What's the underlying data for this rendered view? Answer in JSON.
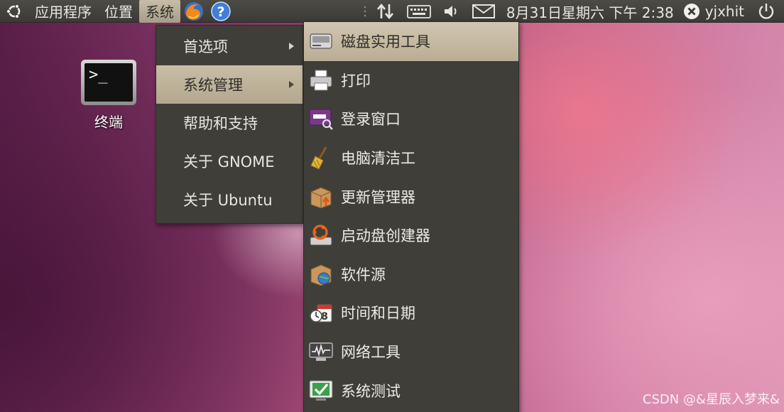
{
  "top_panel": {
    "menus": [
      "应用程序",
      "位置",
      "系统"
    ],
    "active_menu": "系统",
    "launchers": [
      "firefox-icon",
      "help-icon"
    ],
    "tray_icons": [
      "network-icon",
      "keyboard-icon",
      "volume-icon",
      "mail-icon"
    ],
    "clock": "8月31日星期六 下午 2:38",
    "user": "yjxhit",
    "power_icon": "power-icon"
  },
  "desktop": {
    "icons": [
      {
        "label": "终端",
        "icon": "terminal-icon",
        "glyph": ">_"
      }
    ]
  },
  "system_menu": {
    "items": [
      {
        "label": "首选项",
        "submenu": true,
        "highlighted": false
      },
      {
        "label": "系统管理",
        "submenu": true,
        "highlighted": true
      },
      {
        "label": "帮助和支持",
        "submenu": false,
        "highlighted": false
      },
      {
        "label": "关于 GNOME",
        "submenu": false,
        "highlighted": false
      },
      {
        "label": "关于 Ubuntu",
        "submenu": false,
        "highlighted": false
      }
    ]
  },
  "admin_menu": {
    "items": [
      {
        "label": "磁盘实用工具",
        "icon": "disk-utility-icon",
        "highlighted": true
      },
      {
        "label": "打印",
        "icon": "printer-icon",
        "highlighted": false
      },
      {
        "label": "登录窗口",
        "icon": "login-window-icon",
        "highlighted": false
      },
      {
        "label": "电脑清洁工",
        "icon": "broom-icon",
        "highlighted": false
      },
      {
        "label": "更新管理器",
        "icon": "update-manager-icon",
        "highlighted": false
      },
      {
        "label": "启动盘创建器",
        "icon": "startup-disk-icon",
        "highlighted": false
      },
      {
        "label": "软件源",
        "icon": "software-sources-icon",
        "highlighted": false
      },
      {
        "label": "时间和日期",
        "icon": "calendar-icon",
        "highlighted": false
      },
      {
        "label": "网络工具",
        "icon": "network-tools-icon",
        "highlighted": false
      },
      {
        "label": "系统测试",
        "icon": "checkbox-icon",
        "highlighted": false
      }
    ]
  },
  "watermark": "CSDN @&星辰入梦来&"
}
